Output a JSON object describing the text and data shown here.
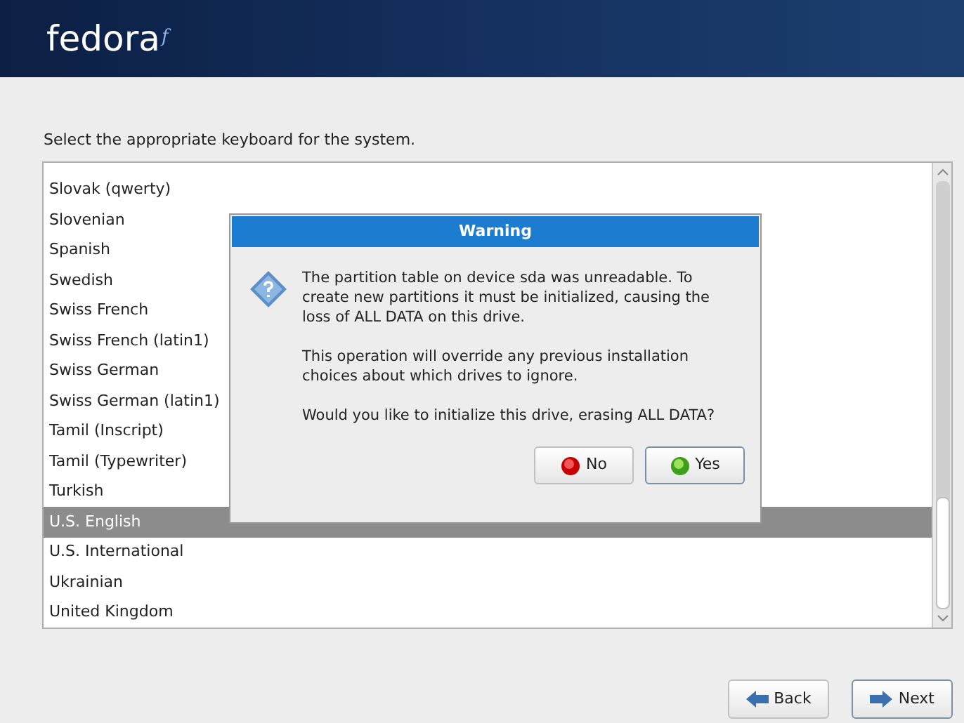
{
  "header": {
    "logo": "fedora",
    "logo_mark": "f"
  },
  "prompt": "Select the appropriate keyboard for the system.",
  "keyboards": [
    {
      "label": "Slovak (qwerty)",
      "selected": false
    },
    {
      "label": "Slovenian",
      "selected": false
    },
    {
      "label": "Spanish",
      "selected": false
    },
    {
      "label": "Swedish",
      "selected": false
    },
    {
      "label": "Swiss French",
      "selected": false
    },
    {
      "label": "Swiss French (latin1)",
      "selected": false
    },
    {
      "label": "Swiss German",
      "selected": false
    },
    {
      "label": "Swiss German (latin1)",
      "selected": false
    },
    {
      "label": "Tamil (Inscript)",
      "selected": false
    },
    {
      "label": "Tamil (Typewriter)",
      "selected": false
    },
    {
      "label": "Turkish",
      "selected": false
    },
    {
      "label": "U.S. English",
      "selected": true
    },
    {
      "label": "U.S. International",
      "selected": false
    },
    {
      "label": "Ukrainian",
      "selected": false
    },
    {
      "label": "United Kingdom",
      "selected": false
    }
  ],
  "dialog": {
    "title": "Warning",
    "paragraphs": [
      "The partition table on device sda was unreadable. To create new partitions it must be initialized, causing the loss of ALL DATA on this drive.",
      "This operation will override any previous installation choices about which drives to ignore.",
      "Would you like to initialize this drive, erasing ALL DATA?"
    ],
    "buttons": [
      {
        "label": "No",
        "kind": "no",
        "focused": false
      },
      {
        "label": "Yes",
        "kind": "yes",
        "focused": true
      }
    ]
  },
  "nav_buttons": [
    {
      "label": "Back",
      "kind": "back",
      "focused": false
    },
    {
      "label": "Next",
      "kind": "next",
      "focused": true
    }
  ]
}
